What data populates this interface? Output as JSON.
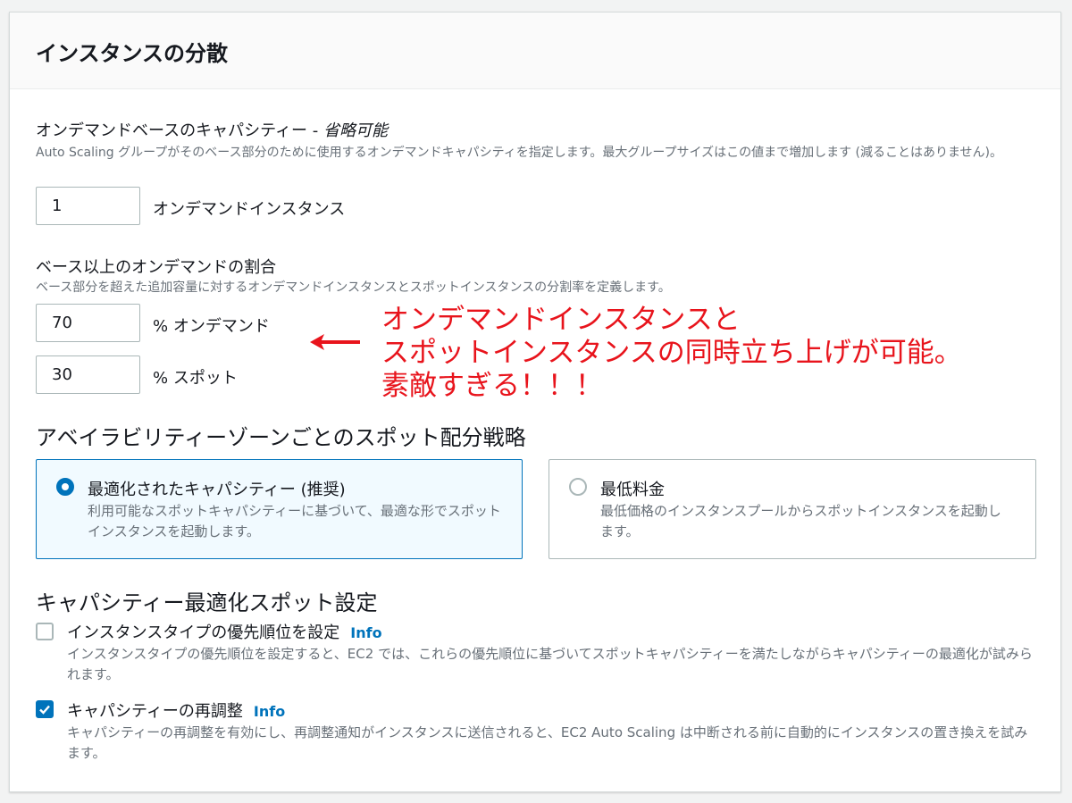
{
  "panel": {
    "title": "インスタンスの分散"
  },
  "on_demand_base": {
    "label": "オンデマンドベースのキャパシティー - ",
    "optional": "省略可能",
    "description": "Auto Scaling グループがそのベース部分のために使用するオンデマンドキャパシティを指定します。最大グループサイズはこの値まで増加します (減ることはありません)。",
    "value": "1",
    "unit": "オンデマンドインスタンス"
  },
  "on_demand_percentage": {
    "label": "ベース以上のオンデマンドの割合",
    "description": "ベース部分を超えた追加容量に対するオンデマンドインスタンスとスポットインスタンスの分割率を定義します。",
    "on_demand_value": "70",
    "on_demand_unit": "% オンデマンド",
    "spot_value": "30",
    "spot_unit": "% スポット"
  },
  "annotation": {
    "line1": "オンデマンドインスタンスと",
    "line2": "スポットインスタンスの同時立ち上げが可能。",
    "line3": "素敵すぎる！！！",
    "color": "#e8141c"
  },
  "allocation_strategy": {
    "heading": "アベイラビリティーゾーンごとのスポット配分戦略",
    "options": [
      {
        "title": "最適化されたキャパシティー (推奨)",
        "description": "利用可能なスポットキャパシティーに基づいて、最適な形でスポットインスタンスを起動します。",
        "selected": true
      },
      {
        "title": "最低料金",
        "description": "最低価格のインスタンスプールからスポットインスタンスを起動します。",
        "selected": false
      }
    ]
  },
  "capacity_settings": {
    "heading": "キャパシティー最適化スポット設定",
    "items": [
      {
        "label": "インスタンスタイプの優先順位を設定",
        "info": "Info",
        "description": "インスタンスタイプの優先順位を設定すると、EC2 では、これらの優先順位に基づいてスポットキャパシティーを満たしながらキャパシティーの最適化が試みられます。",
        "checked": false
      },
      {
        "label": "キャパシティーの再調整",
        "info": "Info",
        "description": "キャパシティーの再調整を有効にし、再調整通知がインスタンスに送信されると、EC2 Auto Scaling は中断される前に自動的にインスタンスの置き換えを試みます。",
        "checked": true
      }
    ]
  },
  "colors": {
    "accent": "#0073bb",
    "text": "#16191f",
    "muted": "#687078"
  }
}
